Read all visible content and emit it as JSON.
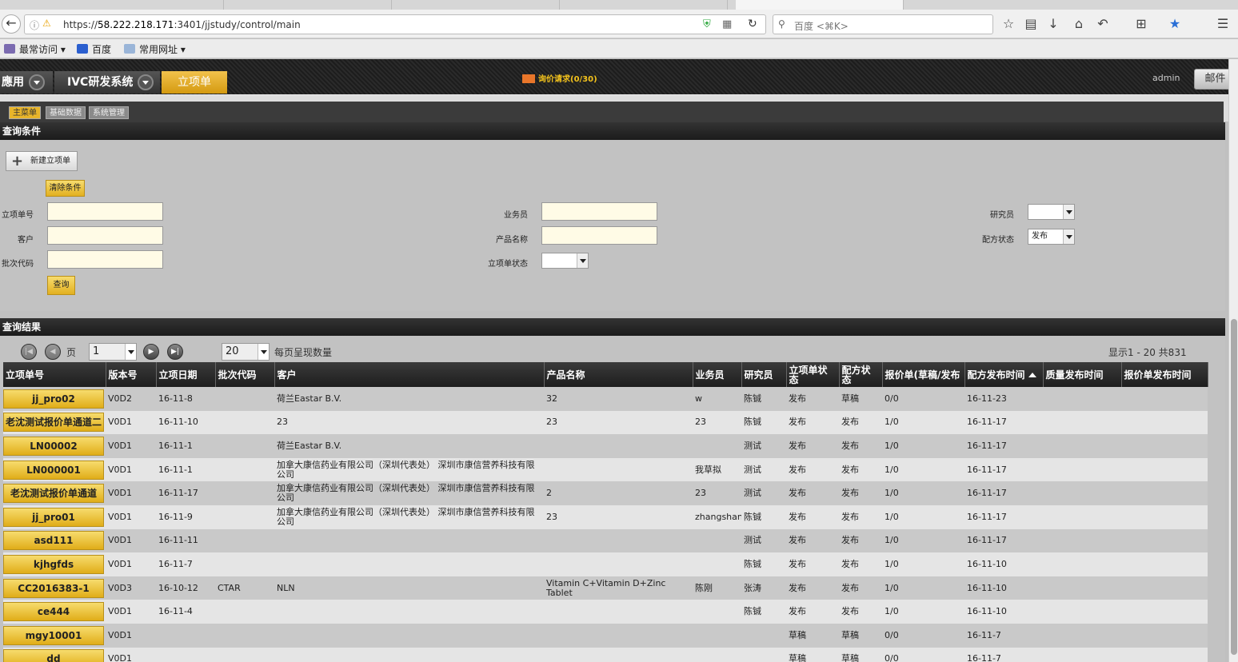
{
  "browser": {
    "url_prefix": "https://",
    "url_host": "58.222.218.171",
    "url_rest": ":3401/jjstudy/control/main",
    "search_placeholder": "百度 <⌘K>",
    "bookmarks": [
      "最常访问",
      "百度",
      "常用网址"
    ]
  },
  "app": {
    "crumbs": [
      "應用",
      "IVC研发系统",
      "立项单"
    ],
    "mail_notice": "询价请求(0/30)",
    "user": "admin",
    "mail_button": "邮件",
    "subtabs": [
      "主菜单",
      "基础数据",
      "系统管理"
    ]
  },
  "query": {
    "title": "查询条件",
    "new_button": "新建立项单",
    "clear_button": "清除条件",
    "search_button": "查询",
    "labels": {
      "id": "立项单号",
      "customer": "客户",
      "batch": "批次代码",
      "sales": "业务员",
      "product": "产品名称",
      "status": "立项单状态",
      "researcher": "研究员",
      "formula_status": "配方状态"
    },
    "formula_status_value": "发布"
  },
  "results": {
    "title": "查询结果",
    "page_label": "页",
    "page_value": "1",
    "page_size": "20",
    "page_size_label": "每页呈现数量",
    "summary": "显示1 - 20 共831",
    "columns": [
      "立项单号",
      "版本号",
      "立项日期",
      "批次代码",
      "客户",
      "产品名称",
      "业务员",
      "研究员",
      "立项单状态",
      "配方状态",
      "报价单(草稿/发布",
      "配方发布时间",
      "质量发布时间",
      "报价单发布时间"
    ],
    "rows": [
      [
        "jj_pro02",
        "V0D2",
        "16-11-8",
        "",
        "荷兰Eastar B.V.",
        "32",
        "w",
        "陈铖",
        "发布",
        "草稿",
        "0/0",
        "16-11-23",
        "",
        ""
      ],
      [
        "老沈测试报价单通道二",
        "V0D1",
        "16-11-10",
        "",
        "23",
        "23",
        "23",
        "陈铖",
        "发布",
        "发布",
        "1/0",
        "16-11-17",
        "",
        ""
      ],
      [
        "LN00002",
        "V0D1",
        "16-11-1",
        "",
        "荷兰Eastar B.V.",
        "",
        "",
        "测试",
        "发布",
        "发布",
        "1/0",
        "16-11-17",
        "",
        ""
      ],
      [
        "LN000001",
        "V0D1",
        "16-11-1",
        "",
        "加拿大康信药业有限公司（深圳代表处） 深圳市康信营养科技有限公司",
        "",
        "我草拟",
        "测试",
        "发布",
        "发布",
        "1/0",
        "16-11-17",
        "",
        ""
      ],
      [
        "老沈测试报价单通道",
        "V0D1",
        "16-11-17",
        "",
        "加拿大康信药业有限公司（深圳代表处） 深圳市康信营养科技有限公司",
        "2",
        "23",
        "测试",
        "发布",
        "发布",
        "1/0",
        "16-11-17",
        "",
        ""
      ],
      [
        "jj_pro01",
        "V0D1",
        "16-11-9",
        "",
        "加拿大康信药业有限公司（深圳代表处） 深圳市康信营养科技有限公司",
        "23",
        "zhangshan",
        "陈铖",
        "发布",
        "发布",
        "1/0",
        "16-11-17",
        "",
        ""
      ],
      [
        "asd111",
        "V0D1",
        "16-11-11",
        "",
        "",
        "",
        "",
        "测试",
        "发布",
        "发布",
        "1/0",
        "16-11-17",
        "",
        ""
      ],
      [
        "kjhgfds",
        "V0D1",
        "16-11-7",
        "",
        "",
        "",
        "",
        "陈铖",
        "发布",
        "发布",
        "1/0",
        "16-11-10",
        "",
        ""
      ],
      [
        "CC2016383-1",
        "V0D3",
        "16-10-12",
        "CTAR",
        "NLN",
        "Vitamin C+Vitamin D+Zinc Tablet",
        "陈刚",
        "张涛",
        "发布",
        "发布",
        "1/0",
        "16-11-10",
        "",
        ""
      ],
      [
        "ce444",
        "V0D1",
        "16-11-4",
        "",
        "",
        "",
        "",
        "陈铖",
        "发布",
        "发布",
        "1/0",
        "16-11-10",
        "",
        ""
      ],
      [
        "mgy10001",
        "V0D1",
        "",
        "",
        "",
        "",
        "",
        "",
        "草稿",
        "草稿",
        "0/0",
        "16-11-7",
        "",
        ""
      ],
      [
        "dd",
        "V0D1",
        "",
        "",
        "",
        "",
        "",
        "",
        "草稿",
        "草稿",
        "0/0",
        "16-11-7",
        "",
        ""
      ]
    ]
  }
}
